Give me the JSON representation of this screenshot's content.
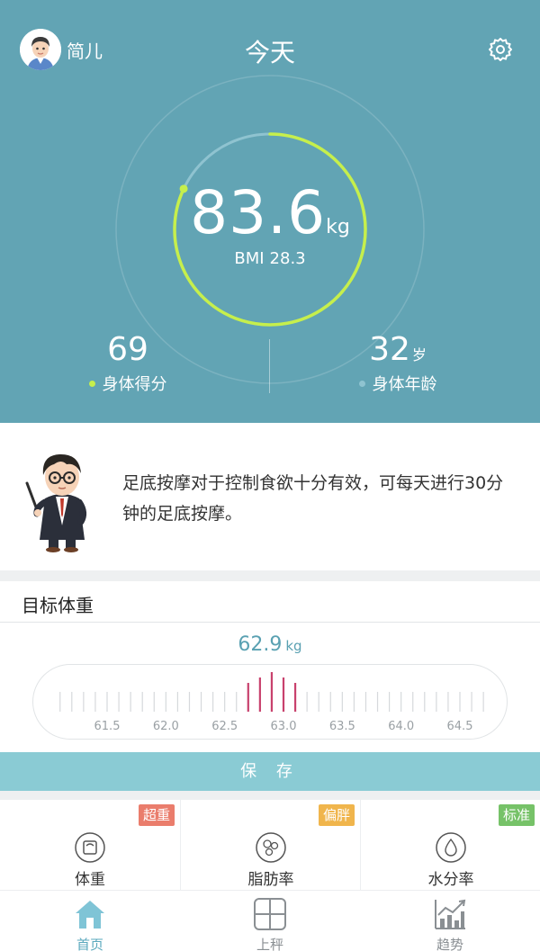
{
  "header": {
    "username": "简儿",
    "title": "今天"
  },
  "summary": {
    "weight": "83.6",
    "weight_unit": "kg",
    "bmi_label": "BMI",
    "bmi_value": "28.3",
    "progress_fraction": 0.82,
    "body_score": "69",
    "body_score_label": "身体得分",
    "body_age": "32",
    "body_age_unit": "岁",
    "body_age_label": "身体年龄"
  },
  "tip": {
    "text": "足底按摩对于控制食欲十分有效，可每天进行30分钟的足底按摩。"
  },
  "goal": {
    "title": "目标体重",
    "value": "62.9",
    "unit": "kg",
    "ruler_labels": [
      "61.5",
      "62.0",
      "62.5",
      "63.0",
      "63.5",
      "64.0",
      "64.5"
    ],
    "save_label": "保 存"
  },
  "metrics": [
    {
      "label": "体重",
      "badge": "超重",
      "badge_color": "#ea7d6c",
      "icon": "scale-icon"
    },
    {
      "label": "脂肪率",
      "badge": "偏胖",
      "badge_color": "#f0b54c",
      "icon": "fat-icon"
    },
    {
      "label": "水分率",
      "badge": "标准",
      "badge_color": "#76c268",
      "icon": "water-drop-icon"
    }
  ],
  "tabs": [
    {
      "label": "首页",
      "icon": "home-icon",
      "active": true
    },
    {
      "label": "上秤",
      "icon": "scale-grid-icon",
      "active": false
    },
    {
      "label": "趋势",
      "icon": "trend-chart-icon",
      "active": false
    }
  ],
  "colors": {
    "header_bg": "#62a4b4",
    "ring_progress": "#c6ef4c",
    "ring_track": "#8fc3d0",
    "accent": "#5aa8bd",
    "ruler_highlight": "#c8416d",
    "save_bg": "#8acbd4"
  }
}
